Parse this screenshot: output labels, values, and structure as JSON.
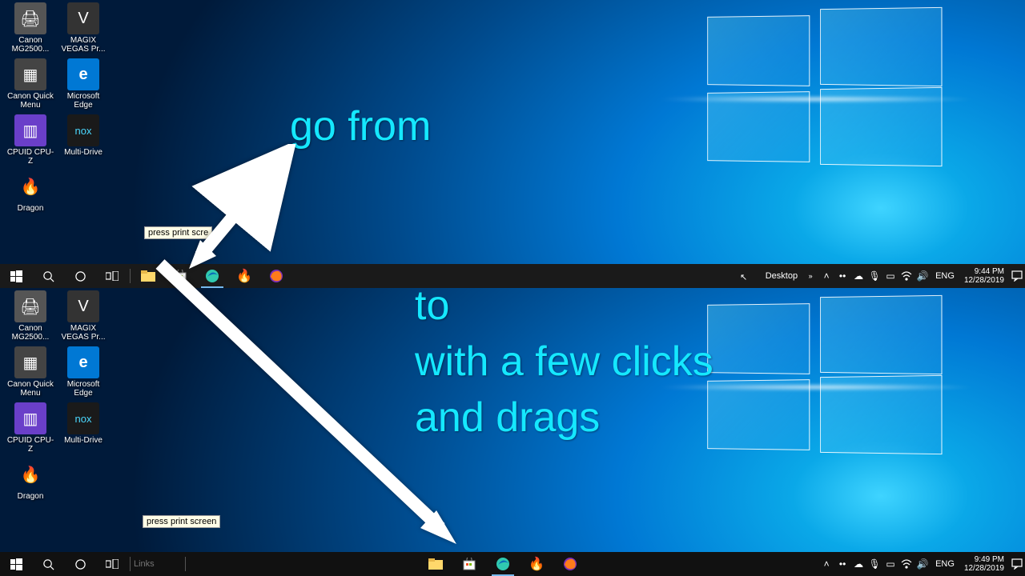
{
  "desktop_icons": [
    {
      "label": "Canon MG2500...",
      "color": "#555",
      "glyph": "🖨"
    },
    {
      "label": "MAGIX VEGAS Pr...",
      "color": "#333",
      "glyph": "V"
    },
    {
      "label": "Canon Quick Menu",
      "color": "#444",
      "glyph": "▦"
    },
    {
      "label": "Microsoft Edge",
      "color": "#0078d4",
      "glyph": "e"
    },
    {
      "label": "CPUID CPU-Z",
      "color": "#6a3fc9",
      "glyph": "▥"
    },
    {
      "label": "Multi-Drive",
      "color": "#1a1a1a",
      "glyph": "∩"
    },
    {
      "label": "Dragon",
      "color": "transparent",
      "glyph": "🔥"
    }
  ],
  "tooltip_top": "press print scre",
  "tooltip_bottom": "press print screen",
  "overlay": {
    "line1": "go from",
    "line2": "to",
    "line3": "with a few clicks",
    "line4": "and drags"
  },
  "taskbar_top": {
    "tray_label": "Desktop",
    "lang": "ENG",
    "time": "9:44 PM",
    "date": "12/28/2019"
  },
  "taskbar_bottom": {
    "links_placeholder": "Links",
    "lang": "ENG",
    "time": "9:49 PM",
    "date": "12/28/2019"
  },
  "overlay_color": "#15e8ff"
}
